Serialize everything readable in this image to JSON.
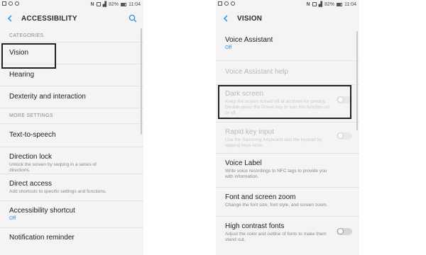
{
  "status_bar": {
    "battery": "82%",
    "time": "11:04"
  },
  "left_screen": {
    "title": "ACCESSIBILITY",
    "categories_header": "CATEGORIES",
    "categories": [
      {
        "label": "Vision"
      },
      {
        "label": "Hearing"
      },
      {
        "label": "Dexterity and interaction"
      }
    ],
    "more_settings_header": "MORE SETTINGS",
    "more_settings": [
      {
        "label": "Text-to-speech"
      },
      {
        "label": "Direction lock",
        "sub": "Unlock the screen by swiping in a series of directions."
      },
      {
        "label": "Direct access",
        "sub": "Add shortcuts to specific settings and functions."
      },
      {
        "label": "Accessibility shortcut",
        "value": "Off"
      },
      {
        "label": "Notification reminder"
      }
    ]
  },
  "right_screen": {
    "title": "VISION",
    "items": [
      {
        "label": "Voice Assistant",
        "value": "Off"
      },
      {
        "label": "Voice Assistant help"
      },
      {
        "label": "Dark screen",
        "sub": "Keep the screen turned off at all times for privacy. Double press the Power key to turn this function on or off."
      },
      {
        "label": "Rapid key input",
        "sub": "Use the Samsung Keyboard and the keypad by tapping keys once."
      },
      {
        "label": "Voice Label",
        "sub": "Write voice recordings to NFC tags to provide you with information."
      },
      {
        "label": "Font and screen zoom",
        "sub": "Change the font size, font style, and screen zoom."
      },
      {
        "label": "High contrast fonts",
        "sub": "Adjust the color and outline of fonts to make them stand out."
      }
    ]
  },
  "colors": {
    "accent": "#2a8de0",
    "background": "#f4f4f4",
    "divider": "#e2e2e2",
    "highlight_border": "#222222"
  },
  "icons": [
    "back-arrow-icon",
    "search-icon",
    "battery-icon",
    "signal-icon",
    "nfc-icon",
    "mute-icon"
  ]
}
